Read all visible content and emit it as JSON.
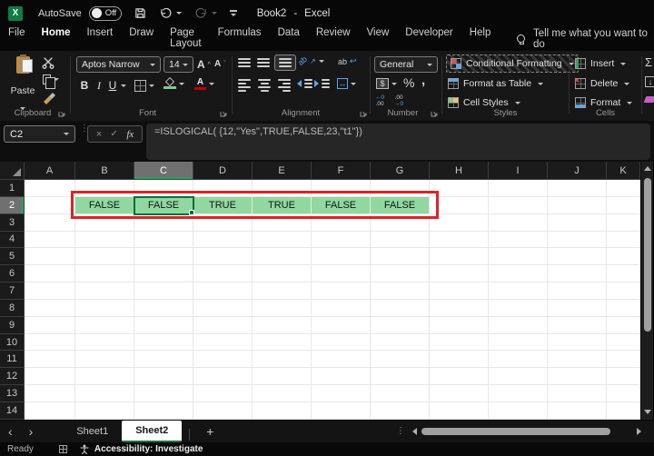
{
  "title_bar": {
    "logo_letter": "X",
    "autosave_label": "AutoSave",
    "autosave_state": "Off",
    "document_title": "Book2",
    "separator": "-",
    "app_name": "Excel"
  },
  "ribbon_tabs": [
    {
      "label": "File",
      "active": false
    },
    {
      "label": "Home",
      "active": true
    },
    {
      "label": "Insert",
      "active": false
    },
    {
      "label": "Draw",
      "active": false
    },
    {
      "label": "Page Layout",
      "active": false
    },
    {
      "label": "Formulas",
      "active": false
    },
    {
      "label": "Data",
      "active": false
    },
    {
      "label": "Review",
      "active": false
    },
    {
      "label": "View",
      "active": false
    },
    {
      "label": "Developer",
      "active": false
    },
    {
      "label": "Help",
      "active": false
    }
  ],
  "search": {
    "label": "Tell me what you want to do"
  },
  "ribbon": {
    "clipboard": {
      "group_label": "Clipboard",
      "paste_label": "Paste"
    },
    "font": {
      "group_label": "Font",
      "font_name": "Aptos Narrow",
      "font_size": "14",
      "bold": "B",
      "italic": "I",
      "underline": "U",
      "grow": "A",
      "shrink": "A"
    },
    "alignment": {
      "group_label": "Alignment",
      "orientation": "ab",
      "wrap": "ab"
    },
    "number": {
      "group_label": "Number",
      "format": "General",
      "percent": "%",
      "comma": ",",
      "inc_top": "←0",
      "inc_bot": ".00",
      "dec_top": ".00",
      "dec_bot": "→0"
    },
    "styles": {
      "group_label": "Styles",
      "conditional_formatting": "Conditional Formatting",
      "format_as_table": "Format as Table",
      "cell_styles": "Cell Styles"
    },
    "cells": {
      "group_label": "Cells",
      "insert": "Insert",
      "delete": "Delete",
      "format": "Format"
    },
    "editing": {
      "autosum": "Σ"
    }
  },
  "formula_bar": {
    "name_box": "C2",
    "cancel": "×",
    "enter": "✓",
    "fx": "fx",
    "formula": "=ISLOGICAL( {12,\"Yes\",TRUE,FALSE,23,\"t1\"})"
  },
  "grid": {
    "columns": [
      "A",
      "B",
      "C",
      "D",
      "E",
      "F",
      "G",
      "H",
      "I",
      "J",
      "K"
    ],
    "row_count": 14,
    "selected_column": "C",
    "selected_row": 2,
    "selected_cell": "C2",
    "cells": [
      {
        "ref": "B2",
        "value": "FALSE"
      },
      {
        "ref": "C2",
        "value": "FALSE"
      },
      {
        "ref": "D2",
        "value": "TRUE"
      },
      {
        "ref": "E2",
        "value": "TRUE"
      },
      {
        "ref": "F2",
        "value": "FALSE"
      },
      {
        "ref": "G2",
        "value": "FALSE"
      }
    ],
    "highlight_fill": "#90D8A0",
    "annotation_color": "#DC2426"
  },
  "sheet_bar": {
    "tabs": [
      {
        "label": "Sheet1",
        "active": false
      },
      {
        "label": "Sheet2",
        "active": true
      }
    ],
    "add_label": "+"
  },
  "status_bar": {
    "mode": "Ready",
    "accessibility": "Accessibility: Investigate"
  },
  "colors": {
    "accent_green": "#21A366",
    "selection_border_green": "#0F6B3D",
    "cell_fill_green": "#90D8A0",
    "annotation_red": "#DC2426",
    "selected_header_gray": "#707070"
  }
}
